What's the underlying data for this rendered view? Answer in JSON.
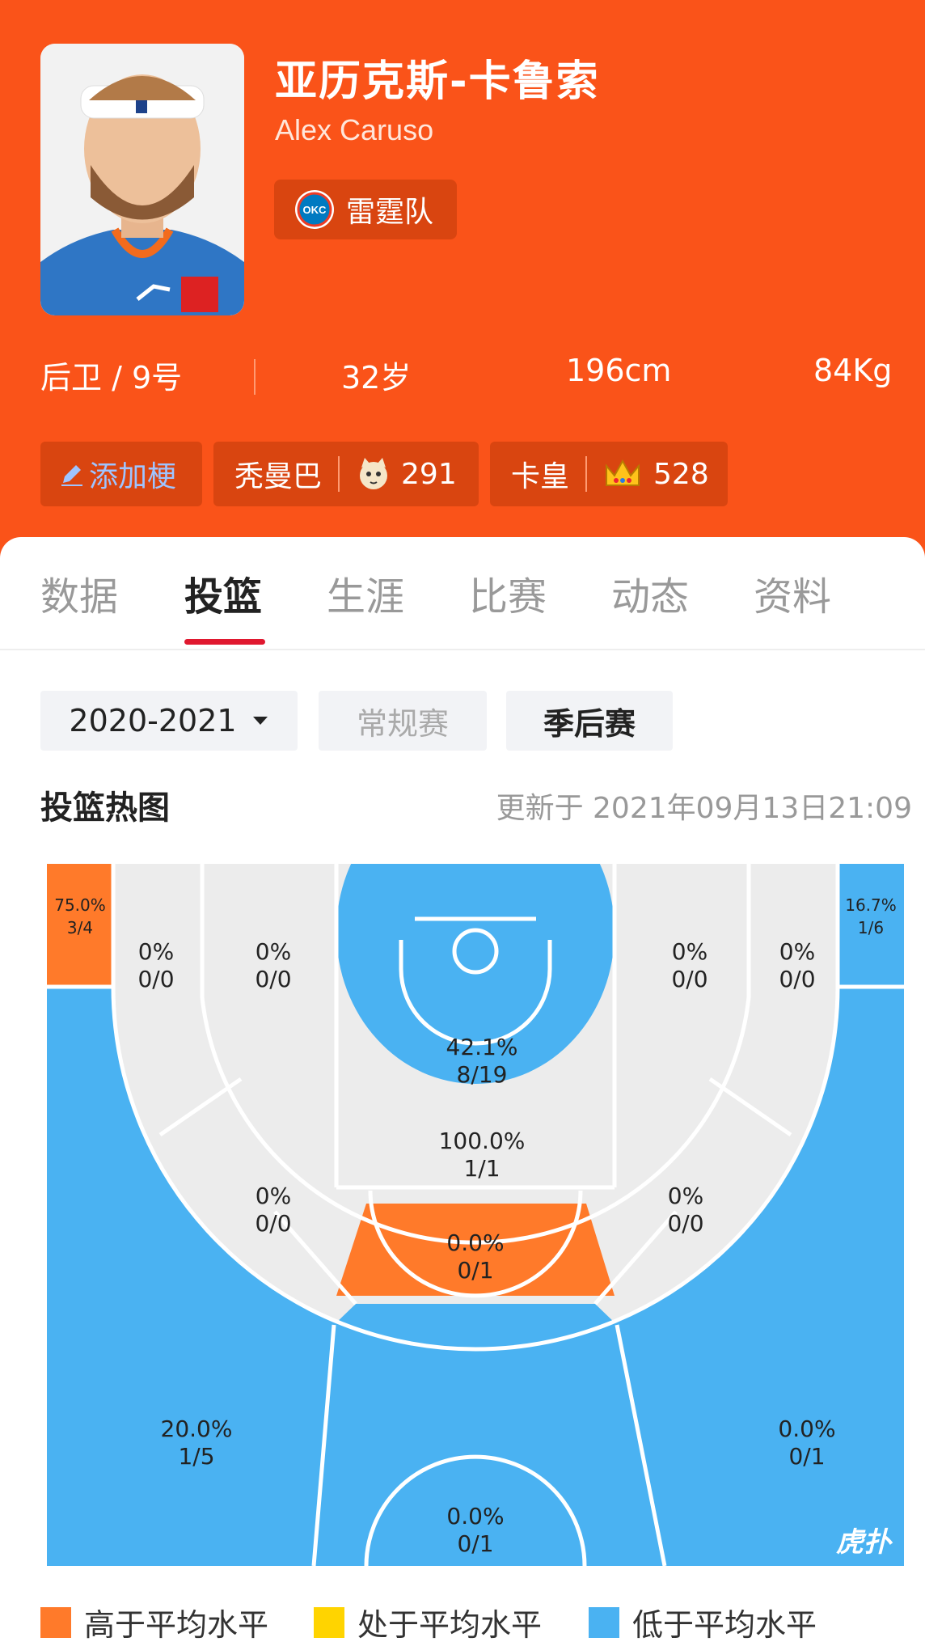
{
  "player": {
    "name_cn": "亚历克斯-卡鲁索",
    "name_en": "Alex Caruso",
    "team": "雷霆队",
    "team_logo_text": "OKC",
    "position": "后卫 / 9号",
    "age": "32岁",
    "height": "196cm",
    "weight": "84Kg"
  },
  "tags": {
    "add": "添加梗",
    "tag1": {
      "label": "秃曼巴",
      "count": "291"
    },
    "tag2": {
      "label": "卡皇",
      "count": "528"
    }
  },
  "tabs": [
    "数据",
    "投篮",
    "生涯",
    "比赛",
    "动态",
    "资料"
  ],
  "active_tab": "投篮",
  "filters": {
    "season": "2020-2021",
    "regular": "常规赛",
    "playoffs": "季后赛"
  },
  "heatmap": {
    "title": "投篮热图",
    "updated": "更新于 2021年09月13日21:09",
    "zones": {
      "left_corner3": {
        "pct": "75.0%",
        "made": "3/4"
      },
      "right_corner3": {
        "pct": "16.7%",
        "made": "1/6"
      },
      "left_base_outer": {
        "pct": "0%",
        "made": "0/0"
      },
      "left_base_inner": {
        "pct": "0%",
        "made": "0/0"
      },
      "right_base_inner": {
        "pct": "0%",
        "made": "0/0"
      },
      "right_base_outer": {
        "pct": "0%",
        "made": "0/0"
      },
      "restricted": {
        "pct": "42.1%",
        "made": "8/19"
      },
      "paint": {
        "pct": "100.0%",
        "made": "1/1"
      },
      "left_elbow": {
        "pct": "0%",
        "made": "0/0"
      },
      "right_elbow": {
        "pct": "0%",
        "made": "0/0"
      },
      "top_mid": {
        "pct": "0.0%",
        "made": "0/1"
      },
      "left_wing3": {
        "pct": "20.0%",
        "made": "1/5"
      },
      "right_wing3": {
        "pct": "0.0%",
        "made": "0/1"
      },
      "top3": {
        "pct": "0.0%",
        "made": "0/1"
      }
    },
    "watermark": "虎扑"
  },
  "legend": [
    {
      "label": "高于平均水平",
      "color": "#ff7a2a"
    },
    {
      "label": "处于平均水平",
      "color": "#ffd400"
    },
    {
      "label": "低于平均水平",
      "color": "#4ab2f2"
    }
  ],
  "colors": {
    "brand": "#fa5319",
    "above": "#ff7a2a",
    "average": "#ffd400",
    "below": "#4ab2f2",
    "none": "#ececec",
    "tab_underline": "#e0182f"
  }
}
